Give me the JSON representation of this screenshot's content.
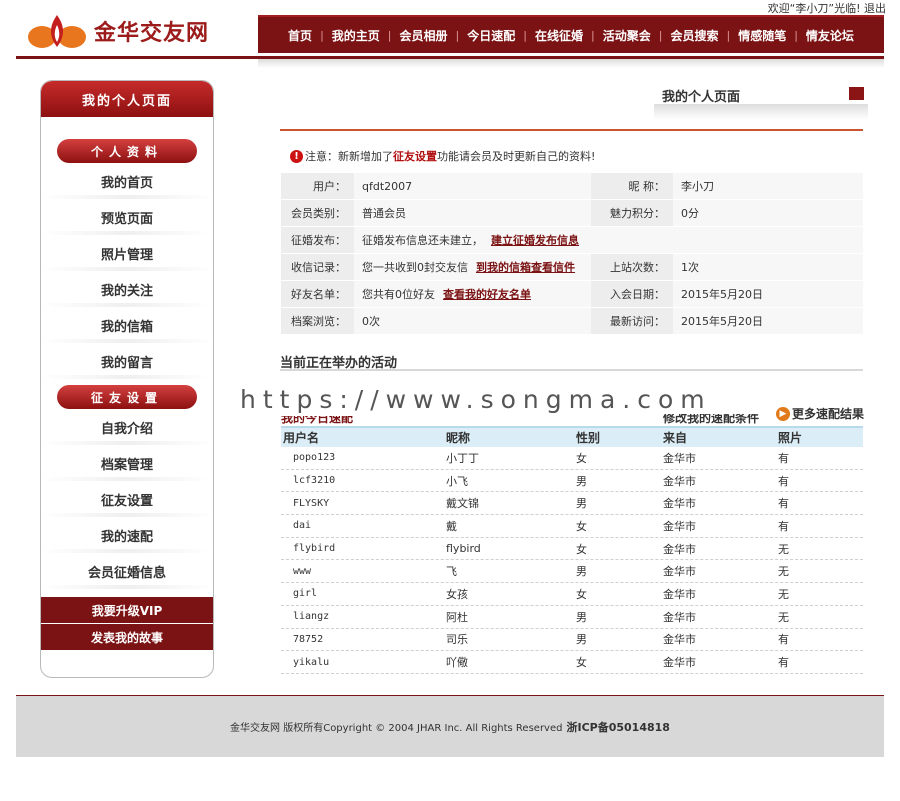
{
  "header": {
    "welcome_prefix": "欢迎“李小刀”光临!",
    "logout_label": "退出",
    "logo_text": "金华交友网",
    "nav": [
      "首页",
      "我的主页",
      "会员相册",
      "今日速配",
      "在线征婚",
      "活动聚会",
      "会员搜索",
      "情感随笔",
      "情友论坛"
    ],
    "nav_separator": "|"
  },
  "sidebar": {
    "title": "我的个人页面",
    "section1_title": "个人资料",
    "section1_items": [
      "我的首页",
      "预览页面",
      "照片管理",
      "我的关注",
      "我的信箱",
      "我的留言"
    ],
    "section2_title": "征友设置",
    "section2_items": [
      "自我介绍",
      "档案管理",
      "征友设置",
      "我的速配",
      "会员征婚信息"
    ],
    "bottom_items": [
      "我要升级VIP",
      "发表我的故事"
    ]
  },
  "main": {
    "page_heading": "我的个人页面",
    "notice": {
      "prefix": "注意：新新增加了",
      "highlight": "征友设置",
      "suffix": "功能请会员及时更新自己的资料!"
    },
    "profile": {
      "username_label": "用户：",
      "username_value": "qfdt2007",
      "nickname_label": "昵 称：",
      "nickname_value": "李小刀",
      "member_type_label": "会员类别：",
      "member_type_value": "普通会员",
      "charm_label": "魅力积分：",
      "charm_value": "0分",
      "marriage_label": "征婚发布：",
      "marriage_value": "征婚发布信息还未建立，",
      "marriage_link": "建立征婚发布信息",
      "mail_label": "收信记录：",
      "mail_value": "您一共收到0封交友信",
      "mail_link": "到我的信箱查看信件",
      "logins_label": "上站次数：",
      "logins_value": "1次",
      "friends_label": "好友名单：",
      "friends_value": "您共有0位好友",
      "friends_link": "查看我的好友名单",
      "join_label": "入会日期：",
      "join_value": "2015年5月20日",
      "views_label": "档案浏览：",
      "views_value": "0次",
      "last_visit_label": "最新访问：",
      "last_visit_value": "2015年5月20日"
    },
    "activity_title": "当前正在举办的活动",
    "watermark": "https://www.songma.com",
    "match_title": "我的今日速配",
    "match_edit_link": "修改我的速配条件",
    "more_results_link": "更多速配结果",
    "results_headers": [
      "用户名",
      "昵称",
      "性别",
      "来自",
      "照片"
    ],
    "results_rows": [
      [
        "popo123",
        "小丁丁",
        "女",
        "金华市",
        "有"
      ],
      [
        "lcf3210",
        "小飞",
        "男",
        "金华市",
        "有"
      ],
      [
        "FLYSKY",
        "戴文锦",
        "男",
        "金华市",
        "有"
      ],
      [
        "dai",
        "戴",
        "女",
        "金华市",
        "有"
      ],
      [
        "flybird",
        "flybird",
        "女",
        "金华市",
        "无"
      ],
      [
        "www",
        "飞",
        "男",
        "金华市",
        "无"
      ],
      [
        "girl",
        "女孩",
        "女",
        "金华市",
        "无"
      ],
      [
        "liangz",
        "阿杜",
        "男",
        "金华市",
        "无"
      ],
      [
        "78752",
        "司乐",
        "男",
        "金华市",
        "有"
      ],
      [
        "yikalu",
        "吖儆",
        "女",
        "金华市",
        "有"
      ]
    ]
  },
  "footer": {
    "copyright": "金华交友网 版权所有Copyright © 2004 JHAR Inc. All Rights Reserved",
    "icp": "浙ICP备05014818"
  },
  "colors": {
    "brand_dark_red": "#7b1213",
    "accent_red": "#b01010",
    "rule_orange": "#c9542f",
    "table_header_blue": "#dbeef7",
    "logo_orange": "#e8761f"
  }
}
